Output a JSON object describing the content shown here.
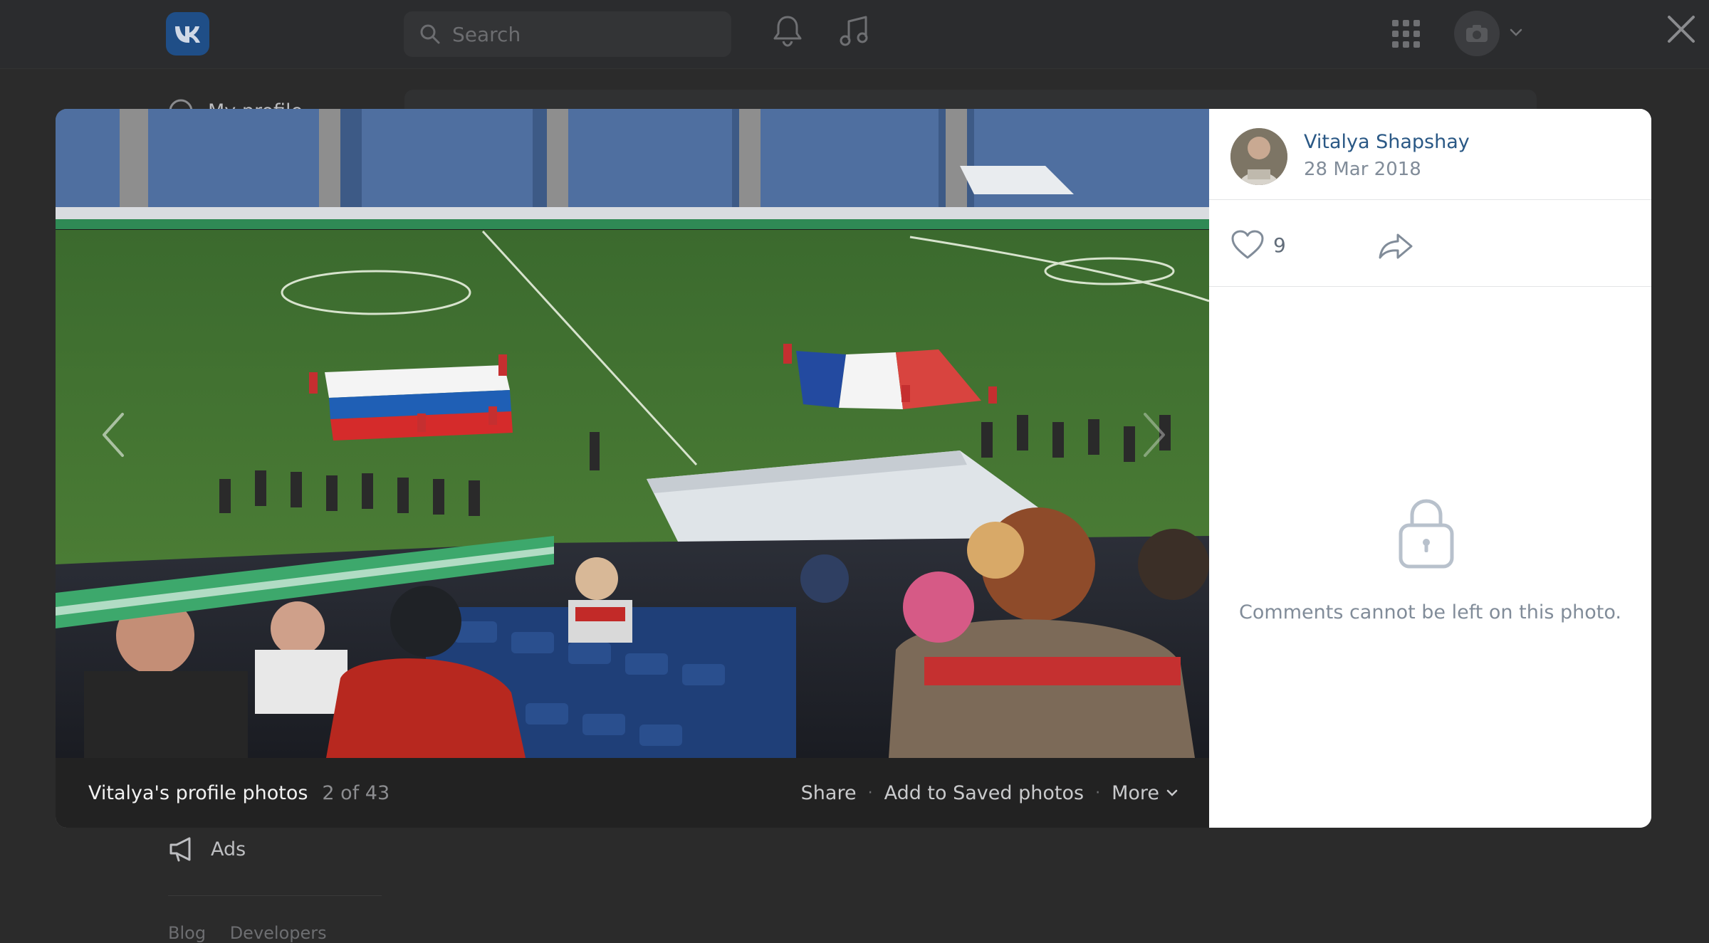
{
  "topbar": {
    "search_placeholder": "Search"
  },
  "background_page": {
    "partial_item_label": "My profile",
    "ads_label": "Ads",
    "footer_links": [
      "Blog",
      "Developers"
    ]
  },
  "viewer": {
    "album_title": "Vitalya's profile photos",
    "counter": "2 of 43",
    "actions": {
      "share": "Share",
      "save": "Add to Saved photos",
      "more": "More"
    },
    "author": {
      "name": "Vitalya Shapshay",
      "date": "28 Mar 2018"
    },
    "likes": "9",
    "comments_note": "Comments cannot be left on this photo."
  },
  "colors": {
    "link": "#2a5885",
    "secondary": "#818c99",
    "overlay": "#2b2b2b"
  },
  "icons": {
    "logo": "vk-logo-icon",
    "search": "search-icon",
    "notifications": "bell-icon",
    "music": "music-note-icon",
    "apps": "grid-icon",
    "close": "close-icon",
    "like": "heart-icon",
    "share": "share-arrow-icon",
    "lock": "lock-icon"
  }
}
